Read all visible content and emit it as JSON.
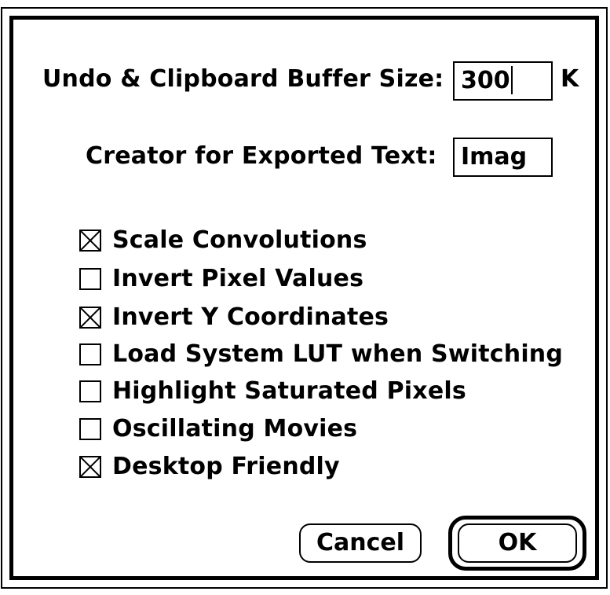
{
  "dialog": {
    "buffer": {
      "label": "Undo & Clipboard Buffer Size:",
      "value": "300",
      "unit": "K"
    },
    "creator": {
      "label": "Creator for Exported Text:",
      "value": "Imag"
    },
    "options": [
      {
        "label": "Scale Convolutions",
        "checked": true
      },
      {
        "label": "Invert Pixel Values",
        "checked": false
      },
      {
        "label": "Invert Y Coordinates",
        "checked": true
      },
      {
        "label": "Load System LUT when Switching",
        "checked": false
      },
      {
        "label": "Highlight Saturated Pixels",
        "checked": false
      },
      {
        "label": "Oscillating Movies",
        "checked": false
      },
      {
        "label": "Desktop Friendly",
        "checked": true
      }
    ],
    "buttons": {
      "cancel": "Cancel",
      "ok": "OK",
      "default": "ok"
    }
  }
}
